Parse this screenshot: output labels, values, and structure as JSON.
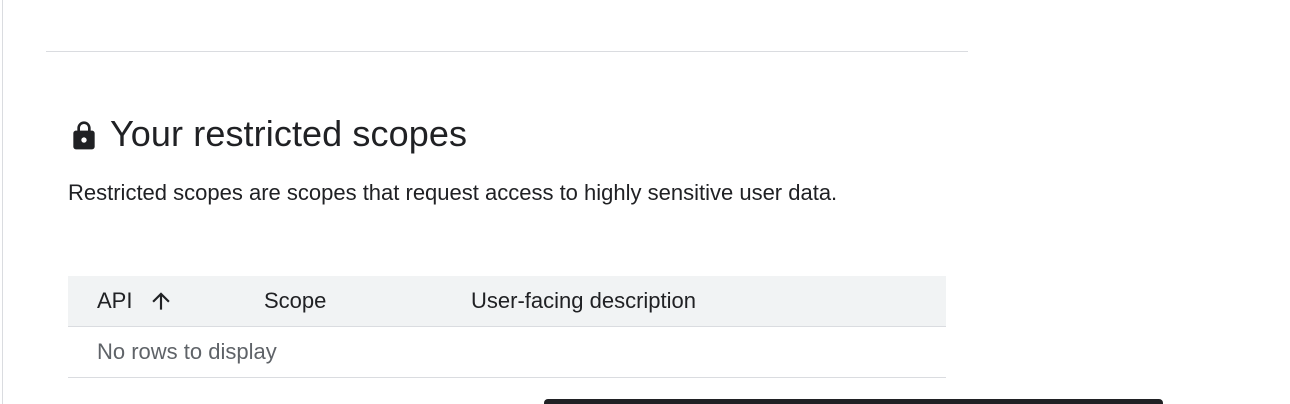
{
  "section": {
    "title": "Your restricted scopes",
    "description": "Restricted scopes are scopes that request access to highly sensitive user data."
  },
  "table": {
    "columns": [
      {
        "label": "API",
        "sort": "ascending"
      },
      {
        "label": "Scope"
      },
      {
        "label": "User-facing description"
      }
    ],
    "empty_message": "No rows to display"
  },
  "icons": {
    "lock": "lock-icon",
    "sort": "arrow-upward-icon"
  }
}
